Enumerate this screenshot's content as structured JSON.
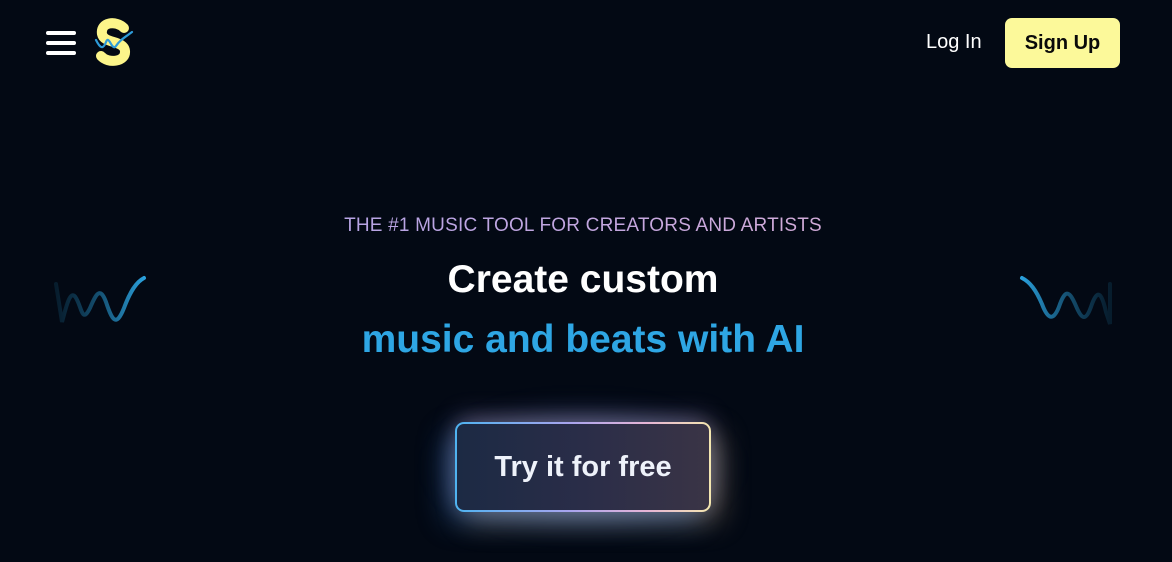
{
  "header": {
    "menu_icon": "hamburger-menu-icon",
    "logo_icon": "s-music-logo",
    "login_label": "Log In",
    "signup_label": "Sign Up"
  },
  "hero": {
    "eyebrow": "THE #1 MUSIC TOOL FOR CREATORS AND ARTISTS",
    "headline_line1": "Create custom",
    "headline_line2": "music and beats with AI",
    "cta_label": "Try it for free",
    "decor_icons": [
      "sound-wave-icon",
      "sound-wave-icon"
    ]
  },
  "colors": {
    "background": "#030914",
    "accent_blue": "#2ea6e4",
    "signup_yellow": "#fcf99a",
    "text_white": "#ffffff"
  }
}
